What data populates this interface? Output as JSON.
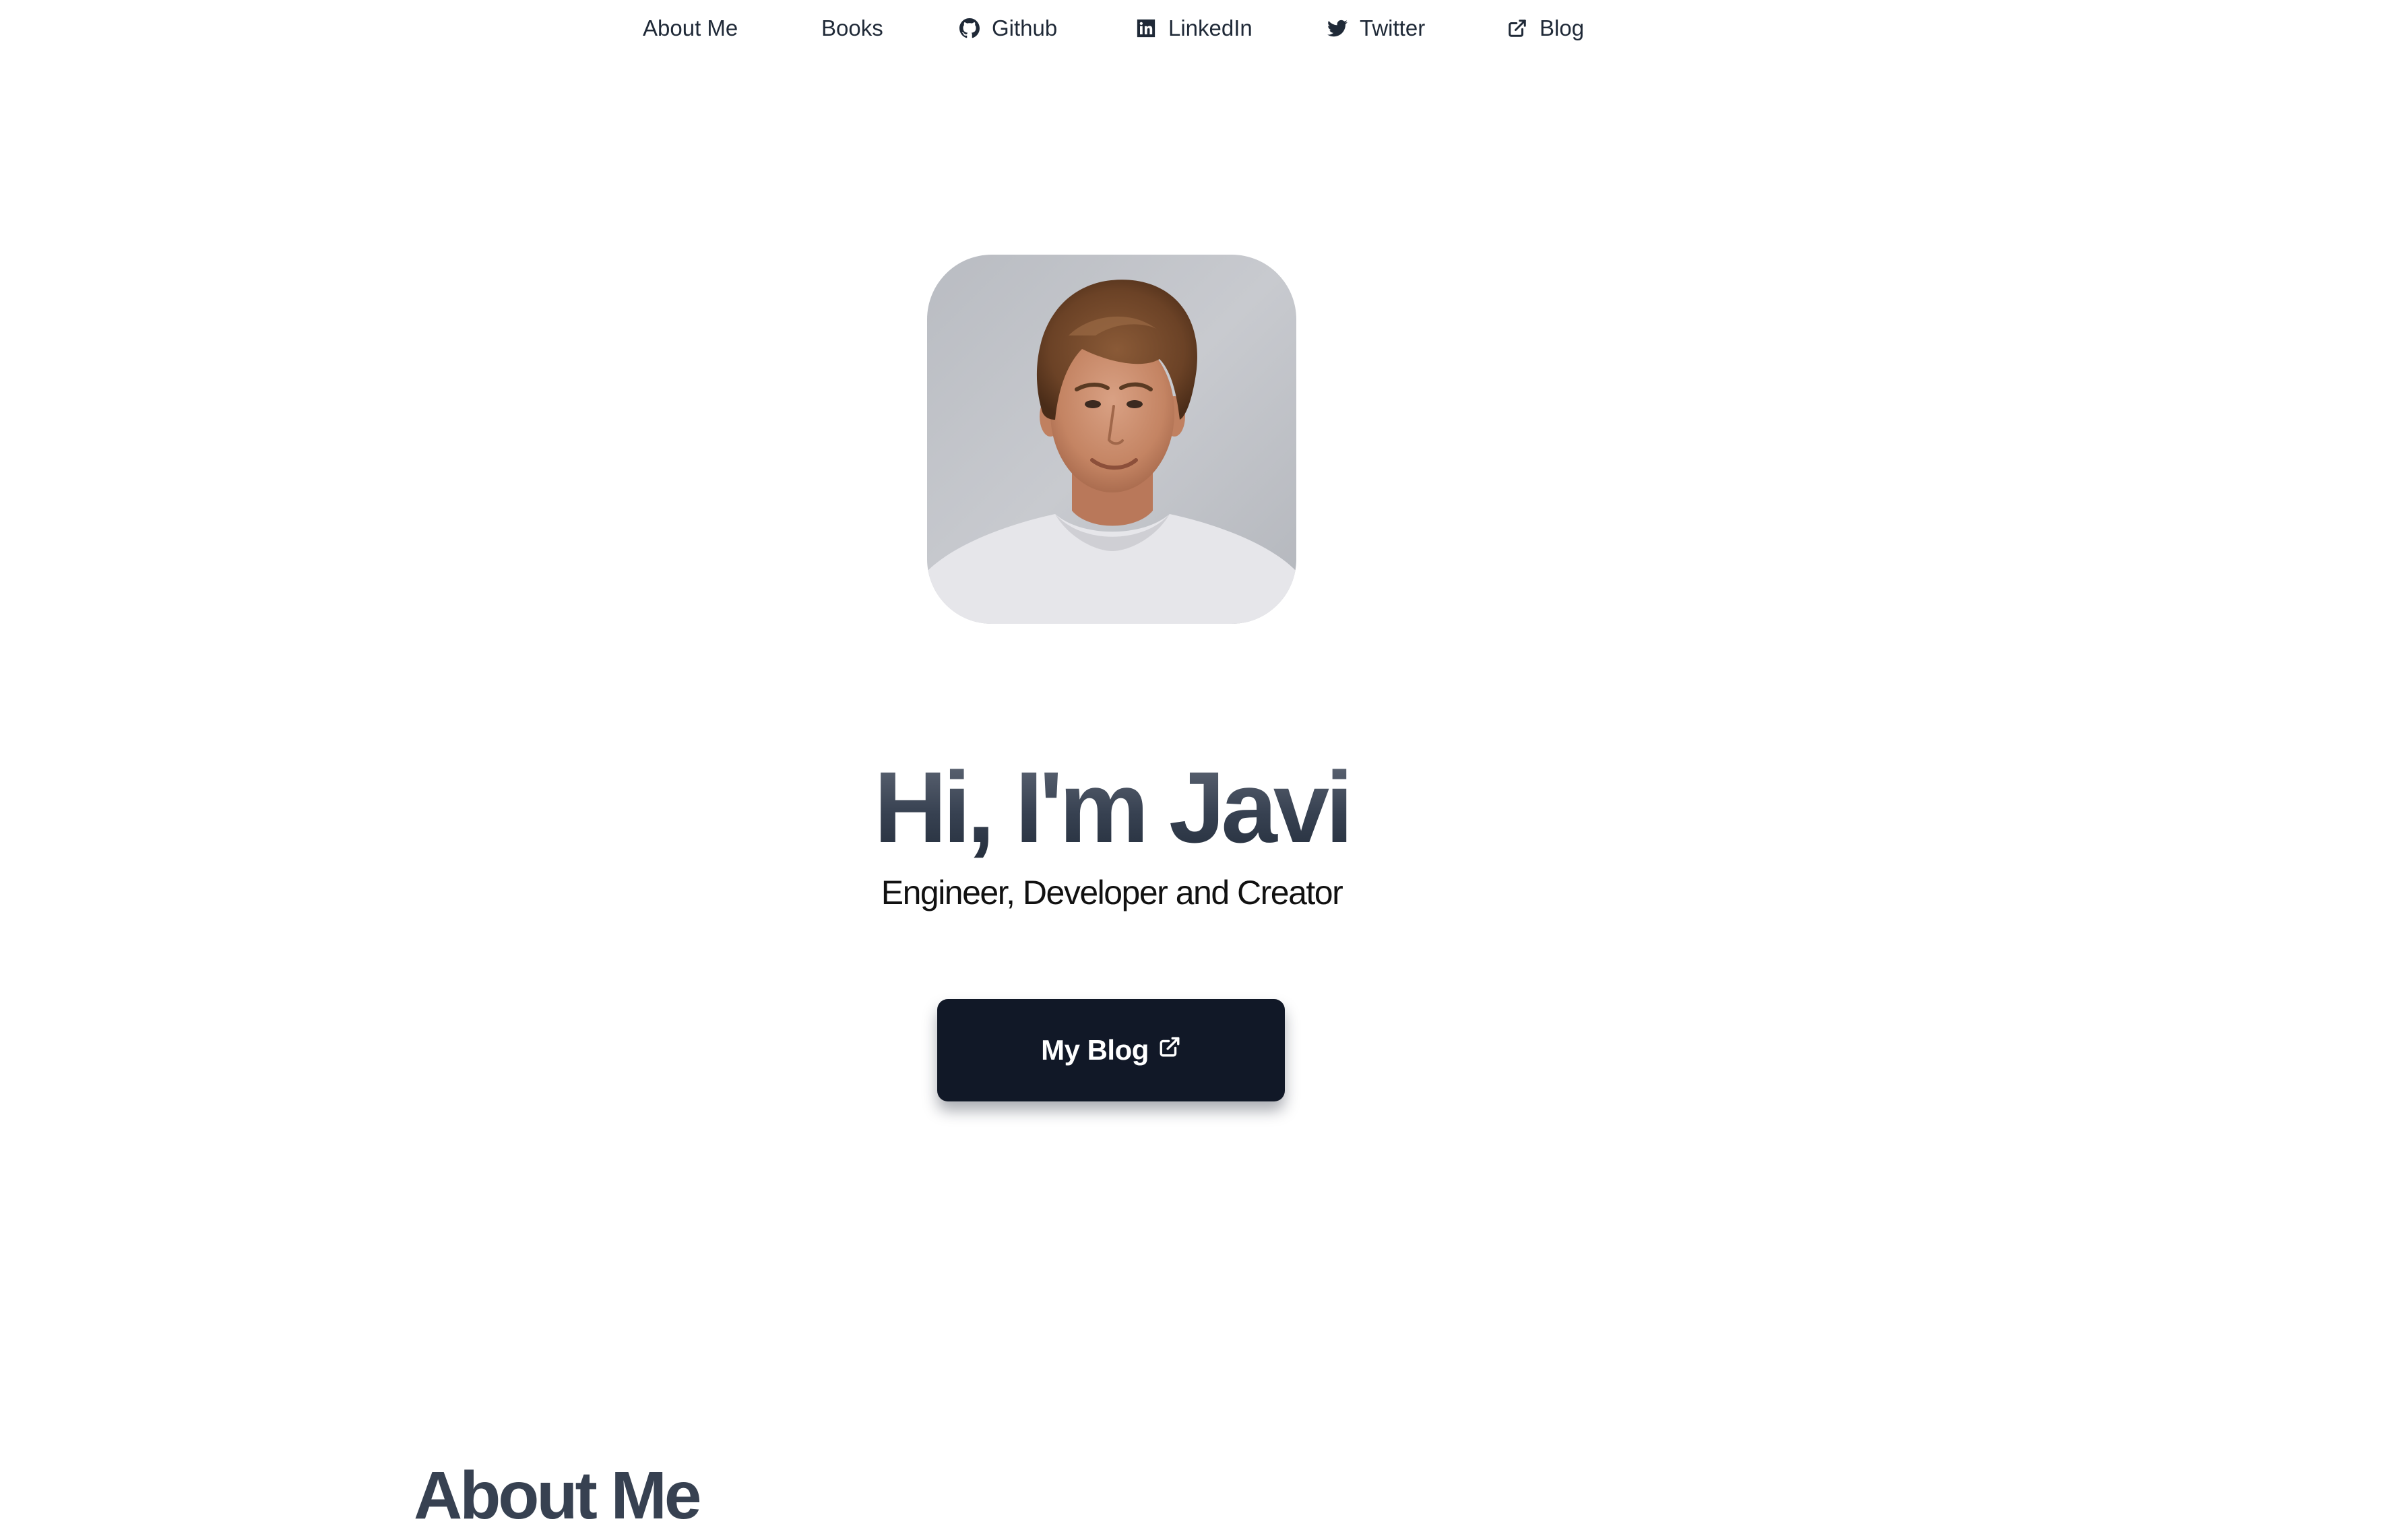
{
  "nav": {
    "items": [
      {
        "label": "About Me",
        "icon": null
      },
      {
        "label": "Books",
        "icon": null
      },
      {
        "label": "Github",
        "icon": "github-icon"
      },
      {
        "label": "LinkedIn",
        "icon": "linkedin-icon"
      },
      {
        "label": "Twitter",
        "icon": "twitter-icon"
      },
      {
        "label": "Blog",
        "icon": "external-link-icon"
      }
    ]
  },
  "hero": {
    "title": "Hi, I'm Javi",
    "subtitle": "Engineer, Developer and Creator",
    "cta_label": "My Blog",
    "cta_icon": "external-link-icon"
  },
  "about": {
    "heading": "About Me"
  },
  "colors": {
    "nav_text": "#1f2937",
    "title_gradient_top": "#6b7280",
    "title_gradient_bottom": "#1f2937",
    "button_bg": "#111827",
    "button_text": "#ffffff",
    "section_heading": "#374151"
  }
}
